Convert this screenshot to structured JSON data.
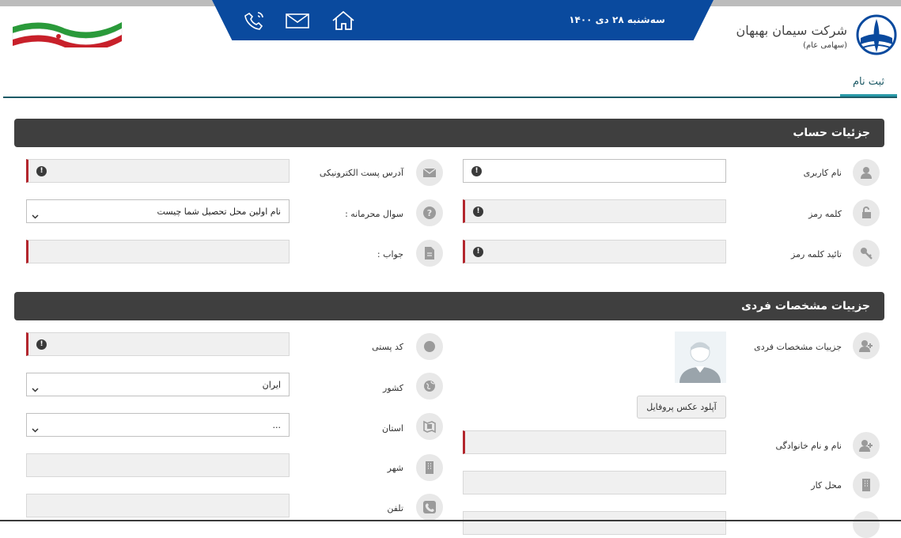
{
  "header": {
    "date": "سه‌شنبه ۲۸ دی ۱۴۰۰",
    "company_name": "شرکت سیمان بهبهان",
    "company_type": "(سهامی عام)",
    "icons": [
      "phone-icon",
      "mail-icon",
      "home-icon"
    ],
    "accent_color": "#0a4a9e"
  },
  "tabs": {
    "register": "ثبت نام"
  },
  "account_section": {
    "title": "جزئیات حساب",
    "username_label": "نام کاربری",
    "password_label": "کلمه رمز",
    "confirm_password_label": "تائید کلمه رمز",
    "email_label": "آدرس پست الکترونیکی",
    "secret_question_label": "سوال محرمانه :",
    "secret_question_value": "نام اولین محل تحصیل شما چیست",
    "answer_label": "جواب :",
    "username_value": "",
    "email_value": "",
    "answer_value": ""
  },
  "personal_section": {
    "title": "جزییات مشخصات فردی",
    "details_label": "جزییات مشخصات فردی",
    "upload_button": "آپلود عکس پروفایل",
    "fullname_label": "نام و نام خانوادگی",
    "workplace_label": "محل کار",
    "postal_code_label": "کد پستی",
    "country_label": "کشور",
    "country_value": "ایران",
    "province_label": "استان",
    "province_value": "...",
    "city_label": "شهر",
    "phone_label": "تلفن"
  }
}
